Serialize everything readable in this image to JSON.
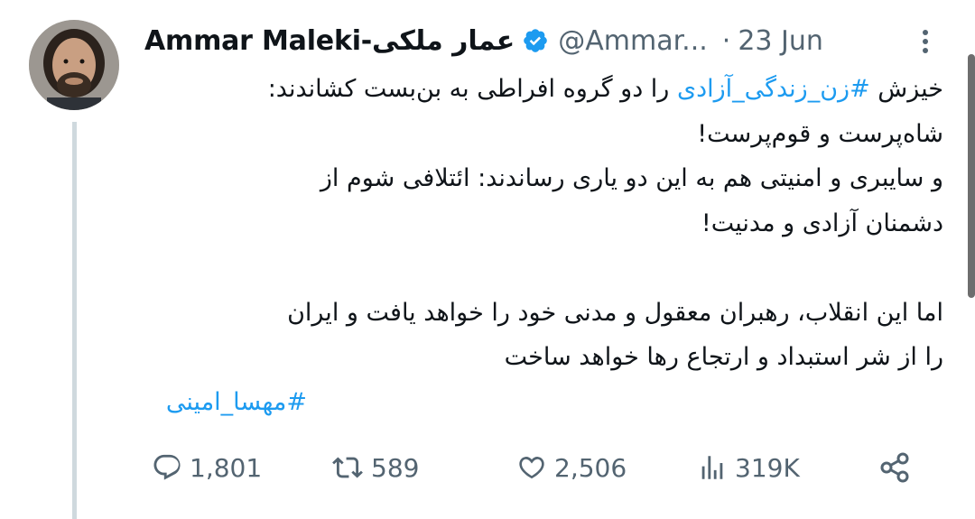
{
  "tweet": {
    "author_name": "Ammar Maleki-عمار ملکی",
    "handle": "@Ammar...",
    "separator": "·",
    "date": "23 Jun",
    "lines": [
      {
        "before": "خیزش ",
        "link": "#زن_زندگی_آزادی",
        "after": " را دو گروه افراطی به بن‌بست کشاندند:"
      },
      {
        "text": "شاه‌پرست و قوم‌پرست!"
      },
      {
        "text": "و سایبری و امنیتی هم به این دو یاری رساندند: ائتلافی شوم از"
      },
      {
        "text": "دشمنان آزادی و مدنیت!"
      },
      {
        "text": "اما این انقلاب، رهبران معقول و مدنی خود را خواهد یافت و ایران"
      },
      {
        "text": "را از شر استبداد و ارتجاع رها خواهد ساخت"
      }
    ],
    "hashtag": "#مهسا_امینی"
  },
  "actions": {
    "replies": "1,801",
    "retweets": "589",
    "likes": "2,506",
    "views": "319K"
  },
  "colors": {
    "link": "#1d9bf0",
    "secondary_text": "#536471",
    "verified": "#1d9bf0",
    "thread_line": "#cfd9de"
  },
  "icons": [
    "verified-badge-icon",
    "more-options-icon",
    "reply-icon",
    "retweet-icon",
    "like-icon",
    "views-icon",
    "share-icon"
  ]
}
